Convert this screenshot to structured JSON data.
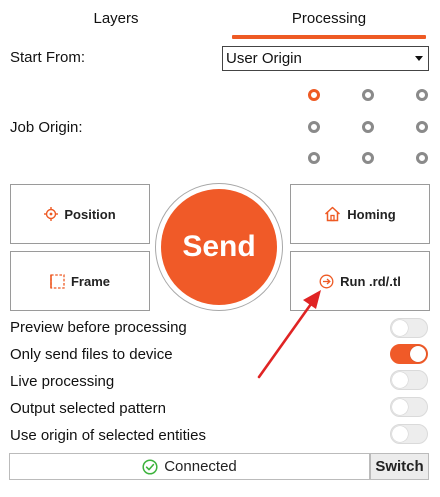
{
  "tabs": [
    {
      "label": "Layers",
      "active": false
    },
    {
      "label": "Processing",
      "active": true
    }
  ],
  "start_from": {
    "label": "Start From:",
    "value": "User Origin"
  },
  "job_origin": {
    "label": "Job Origin:",
    "selected": "top-left"
  },
  "controls": {
    "position_label": "Position",
    "frame_label": "Frame",
    "homing_label": "Homing",
    "run_label": "Run .rd/.tl",
    "send_label": "Send"
  },
  "options": [
    {
      "label": "Preview before processing",
      "on": false
    },
    {
      "label": "Only send files to device",
      "on": true
    },
    {
      "label": "Live processing",
      "on": false
    },
    {
      "label": "Output selected pattern",
      "on": false
    },
    {
      "label": "Use origin of selected entities",
      "on": false
    }
  ],
  "status": {
    "text": "Connected",
    "switch_label": "Switch"
  },
  "colors": {
    "accent": "#ee5a24",
    "connected": "#3db33d"
  }
}
